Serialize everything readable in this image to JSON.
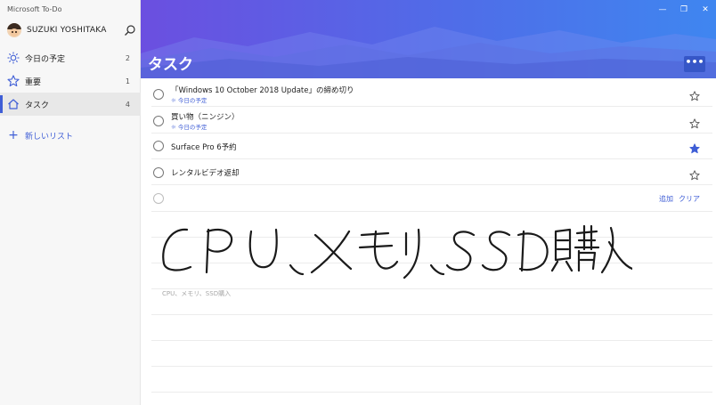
{
  "app": {
    "title": "Microsoft To-Do"
  },
  "user": {
    "name": "SUZUKI YOSHITAKA"
  },
  "sidebar": {
    "items": [
      {
        "label": "今日の予定",
        "count": "2",
        "icon": "sun-icon"
      },
      {
        "label": "重要",
        "count": "1",
        "icon": "star-icon"
      },
      {
        "label": "タスク",
        "count": "4",
        "icon": "home-icon",
        "active": true
      }
    ],
    "new_list_label": "新しいリスト"
  },
  "header": {
    "title": "タスク",
    "more_label": "•••"
  },
  "window_controls": {
    "minimize": "—",
    "maximize": "❐",
    "close": "✕"
  },
  "tasks": [
    {
      "title": "「Windows 10 October 2018 Update」の締め切り",
      "subtitle": "☼ 今日の予定",
      "starred": false
    },
    {
      "title": "買い物（ニンジン）",
      "subtitle": "☼ 今日の予定",
      "starred": false
    },
    {
      "title": "Surface Pro 6予約",
      "subtitle": "",
      "starred": true
    },
    {
      "title": "レンタルビデオ返却",
      "subtitle": "",
      "starred": false
    }
  ],
  "new_task": {
    "add_label": "追加",
    "clear_label": "クリア"
  },
  "ink": {
    "handwriting": "CPU、メモリ、SSD購入",
    "recognized_text": "CPU、メモリ、SSD購入"
  },
  "colors": {
    "accent": "#3f5ed6",
    "header_start": "#6b4fe0",
    "header_end": "#3f86f0"
  }
}
